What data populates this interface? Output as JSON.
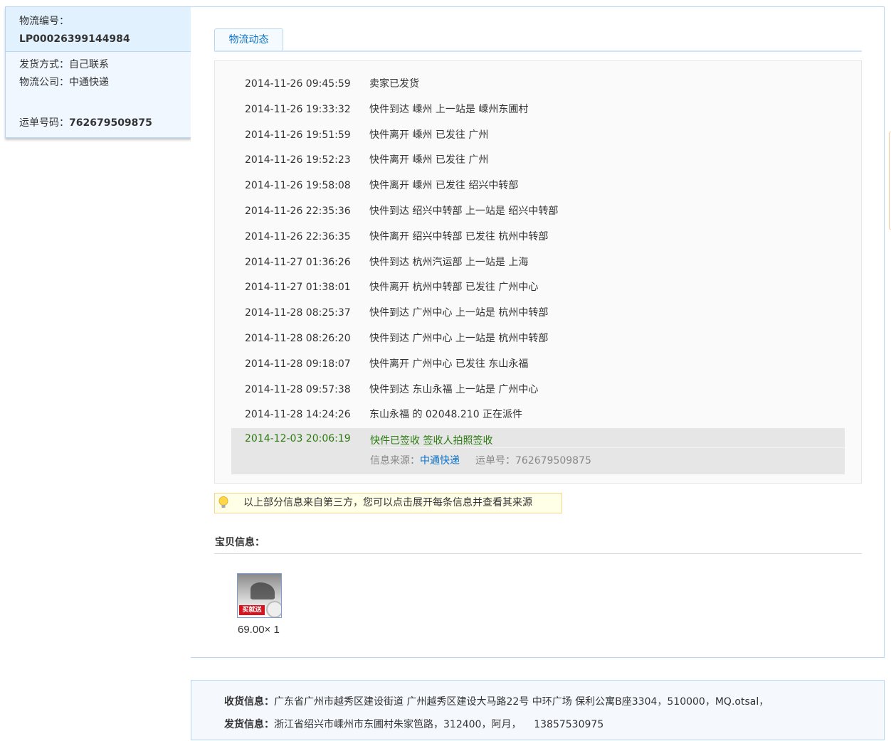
{
  "order": {
    "id_label": "物流编号：",
    "id": "LP00026399144984",
    "ship_method_label": "发货方式：",
    "ship_method": "自己联系",
    "company_label": "物流公司：",
    "company": "中通快递",
    "waybill_label": "运单号码：",
    "waybill": "762679509875"
  },
  "tabs": [
    {
      "label": "物流动态"
    }
  ],
  "events": [
    {
      "time": "2014-11-26 09:45:59",
      "text": "卖家已发货"
    },
    {
      "time": "2014-11-26 19:33:32",
      "text": "快件到达 嵊州 上一站是 嵊州东圃村"
    },
    {
      "time": "2014-11-26 19:51:59",
      "text": "快件离开 嵊州 已发往 广州"
    },
    {
      "time": "2014-11-26 19:52:23",
      "text": "快件离开 嵊州 已发往 广州"
    },
    {
      "time": "2014-11-26 19:58:08",
      "text": "快件离开 嵊州 已发往 绍兴中转部"
    },
    {
      "time": "2014-11-26 22:35:36",
      "text": "快件到达 绍兴中转部 上一站是 绍兴中转部"
    },
    {
      "time": "2014-11-26 22:36:35",
      "text": "快件离开 绍兴中转部 已发往 杭州中转部"
    },
    {
      "time": "2014-11-27 01:36:26",
      "text": "快件到达 杭州汽运部 上一站是 上海"
    },
    {
      "time": "2014-11-27 01:38:01",
      "text": "快件离开 杭州中转部 已发往 广州中心"
    },
    {
      "time": "2014-11-28 08:25:37",
      "text": "快件到达 广州中心 上一站是 杭州中转部"
    },
    {
      "time": "2014-11-28 08:26:20",
      "text": "快件到达 广州中心 上一站是 杭州中转部"
    },
    {
      "time": "2014-11-28 09:18:07",
      "text": "快件离开 广州中心 已发往 东山永福"
    },
    {
      "time": "2014-11-28 09:57:38",
      "text": "快件到达 东山永福 上一站是 广州中心"
    },
    {
      "time": "2014-11-28 14:24:26",
      "text": "东山永福 的 02048.210 正在派件"
    }
  ],
  "last_event": {
    "time": "2014-12-03 20:06:19",
    "text": "快件已签收 签收人拍照签收",
    "source_label": "信息来源：",
    "source": "中通快递",
    "waybill_label": "运单号：",
    "waybill": "762679509875"
  },
  "notice": "以上部分信息来自第三方，您可以点击展开每条信息并查看其来源",
  "items": {
    "title": "宝贝信息：",
    "badge": "买就送",
    "price": "69.00× 1"
  },
  "address": {
    "receive_label": "收货信息：",
    "receive": "广东省广州市越秀区建设街道 广州越秀区建设大马路22号 中环广场 保利公寓B座3304，510000，MQ.otsal，",
    "send_label": "发货信息：",
    "send": "浙江省绍兴市嵊州市东圃村朱家笆路，312400，阿月，    13857530975"
  },
  "colors": {
    "accent": "#0b72c6",
    "success": "#2a7a0e",
    "border": "#b5d6f7"
  }
}
